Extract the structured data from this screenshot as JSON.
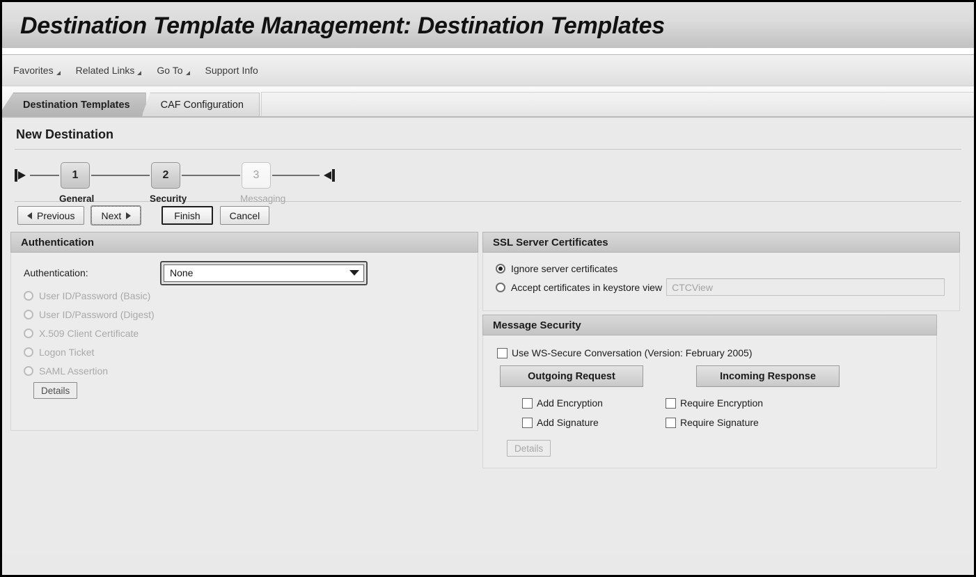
{
  "window": {
    "title": "Destination Template Management: Destination Templates"
  },
  "menubar": {
    "items": [
      {
        "label": "Favorites",
        "has_arrow": true
      },
      {
        "label": "Related Links",
        "has_arrow": true
      },
      {
        "label": "Go To",
        "has_arrow": true
      },
      {
        "label": "Support Info",
        "has_arrow": false
      }
    ]
  },
  "tabstrip": {
    "tabs": [
      {
        "label": "Destination Templates",
        "active": true
      },
      {
        "label": "CAF Configuration",
        "active": false
      }
    ]
  },
  "page": {
    "title": "New Destination"
  },
  "roadmap": {
    "steps": [
      {
        "number": "1",
        "label": "General",
        "state": "done"
      },
      {
        "number": "2",
        "label": "Security",
        "state": "current"
      },
      {
        "number": "3",
        "label": "Messaging",
        "state": "disabled"
      }
    ]
  },
  "toolbar": {
    "previous_label": "Previous",
    "next_label": "Next",
    "finish_label": "Finish",
    "cancel_label": "Cancel"
  },
  "authentication_panel": {
    "header": "Authentication",
    "field_label": "Authentication:",
    "selected_value": "None",
    "options": [
      "None",
      "User ID/Password (Basic)",
      "User ID/Password (Digest)",
      "X.509 Client Certificate",
      "Logon Ticket",
      "SAML Assertion"
    ],
    "radios": [
      {
        "label": "User ID/Password (Basic)",
        "checked": false,
        "disabled": true
      },
      {
        "label": "User ID/Password (Digest)",
        "checked": false,
        "disabled": true
      },
      {
        "label": "X.509 Client Certificate",
        "checked": false,
        "disabled": true
      },
      {
        "label": "Logon Ticket",
        "checked": false,
        "disabled": true
      },
      {
        "label": "SAML Assertion",
        "checked": false,
        "disabled": true
      }
    ],
    "details_label": "Details"
  },
  "ssl_panel": {
    "header": "SSL Server Certificates",
    "ignore_label": "Ignore server certificates",
    "ignore_checked": true,
    "accept_label": "Accept certificates in keystore view",
    "accept_checked": false,
    "keystore_value": "CTCView",
    "keystore_disabled": true
  },
  "message_security_panel": {
    "header": "Message Security",
    "ws_secure_label": "Use WS-Secure Conversation (Version: February 2005)",
    "ws_secure_checked": false,
    "outgoing_tab": "Outgoing Request",
    "incoming_tab": "Incoming Response",
    "outgoing_checkboxes": [
      {
        "label": "Add Encryption",
        "checked": false
      },
      {
        "label": "Add Signature",
        "checked": false
      }
    ],
    "incoming_checkboxes": [
      {
        "label": "Require Encryption",
        "checked": false
      },
      {
        "label": "Require Signature",
        "checked": false
      }
    ],
    "details_label": "Details"
  },
  "colors": {
    "window_border": "#000000",
    "content_bg": "#eaeaea",
    "panel_bg": "#ececec",
    "panel_header_bg": "#cfcfcf",
    "text": "#1b1b1b",
    "disabled_text": "#a9a9a9",
    "active_tab_bg": "#bdbdbd"
  }
}
